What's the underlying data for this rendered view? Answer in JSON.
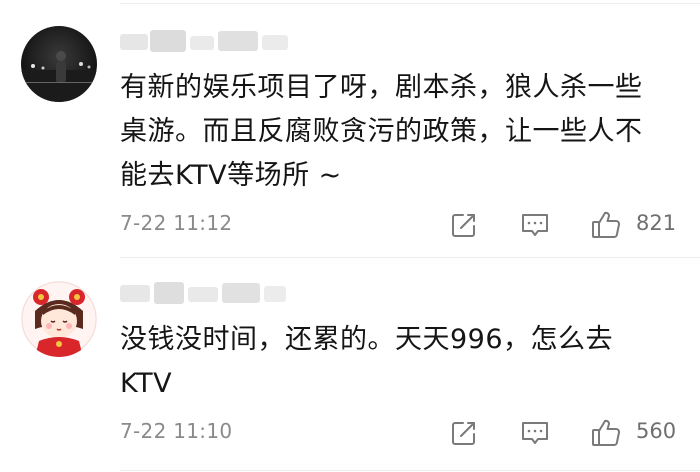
{
  "comments": [
    {
      "avatar": "avatar-night-street",
      "text_lines": [
        "有新的娱乐项目了呀，剧本杀，狼人杀一些",
        "桌游。而且反腐败贪污的政策，让一些人不",
        "能去KTV等场所 ~"
      ],
      "timestamp": "7-22 11:12",
      "likes": "821"
    },
    {
      "avatar": "avatar-cartoon-girl",
      "text_lines": [
        "没钱没时间，还累的。天天996，怎么去",
        "KTV"
      ],
      "timestamp": "7-22 11:10",
      "likes": "560"
    }
  ],
  "icons": {
    "share": "share-icon",
    "reply": "reply-icon",
    "like": "thumbs-up-icon"
  },
  "colors": {
    "text": "#151515",
    "meta": "#8a8a8a",
    "icon": "#7a7a7a",
    "divider": "#ececec"
  }
}
